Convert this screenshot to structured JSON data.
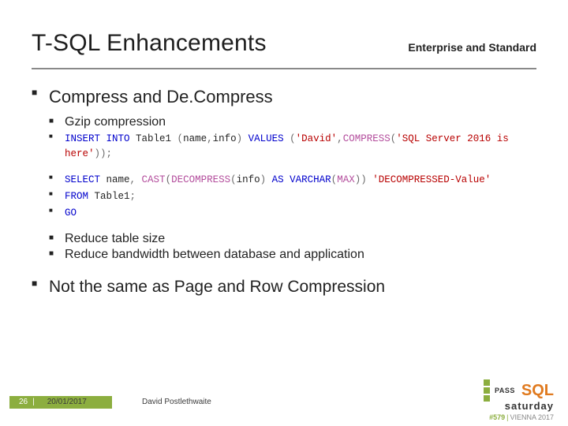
{
  "header": {
    "title": "T-SQL Enhancements",
    "subtitle": "Enterprise and Standard"
  },
  "bullets": {
    "main1": "Compress and De.Compress",
    "sub1": "Gzip compression",
    "code1_a": "INSERT",
    "code1_b": " INTO",
    "code1_c": " Table1 ",
    "code1_d": "(",
    "code1_e": "name",
    "code1_f": ",",
    "code1_g": "info",
    "code1_h": ")",
    "code1_i": " VALUES ",
    "code1_j": "(",
    "code1_k": "'David'",
    "code1_l": ",",
    "code1_m": "COMPRESS",
    "code1_n": "(",
    "code1_o": "'SQL Server 2016 is here'",
    "code1_p": "));",
    "code2_a": "SELECT",
    "code2_b": " name",
    "code2_c": ",",
    "code2_d": " CAST",
    "code2_e": "(",
    "code2_f": "DECOMPRESS",
    "code2_g": "(",
    "code2_h": "info",
    "code2_i": ")",
    "code2_j": " AS ",
    "code2_k": "VARCHAR",
    "code2_l": "(",
    "code2_m": "MAX",
    "code2_n": "))",
    "code2_o": " 'DECOMPRESSED-Value'",
    "code3_a": "FROM",
    "code3_b": " Table1",
    "code3_c": ";",
    "code4_a": "GO",
    "sub2": "Reduce table size",
    "sub3": "Reduce bandwidth between database and application",
    "main2": "Not the same as Page and Row Compression"
  },
  "footer": {
    "page": "26",
    "sep": "|",
    "date": "20/01/2017",
    "author": "David Postlethwaite"
  },
  "logo": {
    "pass": "PASS",
    "sql": "SQL",
    "saturday": "saturday",
    "eventnum": "#579",
    "sep": "|",
    "city": "VIENNA 2017"
  }
}
